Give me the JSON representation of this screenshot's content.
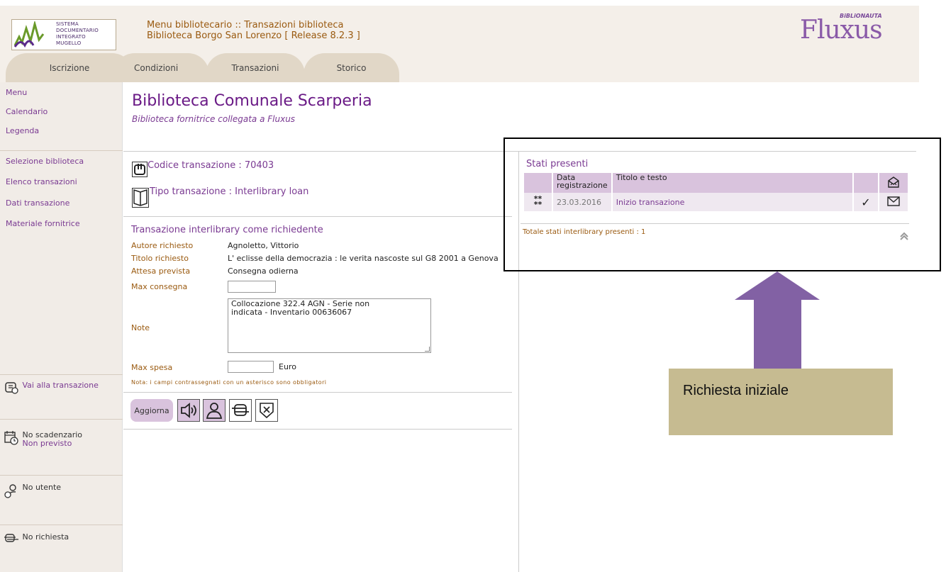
{
  "header": {
    "logo_lines": [
      "SISTEMA",
      "DOCUMENTARIO",
      "INTEGRATO",
      "MUGELLO"
    ],
    "title_line1": "Menu bibliotecario :: Transazioni biblioteca",
    "title_line2": "Biblioteca Borgo San Lorenzo [ Release 8.2.3 ]",
    "brand": "Fluxus",
    "brand_sub": "BiBLiONAUTA"
  },
  "tabs": [
    "Iscrizione",
    "Condizioni",
    "Transazioni",
    "Storico"
  ],
  "sidebar": {
    "menu": [
      "Menu",
      "Calendario",
      "Legenda"
    ],
    "nav": [
      "Selezione biblioteca",
      "Elenco transazioni",
      "Dati transazione",
      "Materiale fornitrice"
    ],
    "vai": "Vai alla transazione",
    "scadenzario_1": "No scadenzario",
    "scadenzario_2": "Non previsto",
    "utente": "No utente",
    "richiesta": "No richiesta"
  },
  "main": {
    "title": "Biblioteca Comunale Scarperia",
    "subtitle": "Biblioteca fornitrice collegata a Fluxus",
    "codice": "Codice transazione : 70403",
    "tipo": "Tipo transazione : Interlibrary loan",
    "section_title": "Transazione interlibrary come richiedente",
    "fields": {
      "autore_label": "Autore richiesto",
      "autore_value": "Agnoletto, Vittorio",
      "titolo_label": "Titolo richiesto",
      "titolo_value": "L' eclisse della democrazia : le verita nascoste sul G8 2001 a Genova",
      "attesa_label": "Attesa prevista",
      "attesa_value": "Consegna odierna",
      "max_consegna_label": "Max consegna",
      "max_consegna_value": "",
      "note_label": "Note",
      "note_line1": "Collocazione 322.4 AGN - Serie non",
      "note_line2": "indicata - Inventario 00636067",
      "max_spesa_label": "Max spesa",
      "max_spesa_value": "",
      "euro": "Euro"
    },
    "nota": "Nota: i campi contrassegnati con un asterisco sono obbligatori",
    "aggiorna": "Aggiorna"
  },
  "stati": {
    "title": "Stati presenti",
    "col_data_1": "Data",
    "col_data_2": "registrazione",
    "col_titolo": "Titolo e testo",
    "row": {
      "marker": "**",
      "marker2": "**",
      "data": "23.03.2016",
      "titolo": "Inizio transazione",
      "check": "✓"
    },
    "totale": "Totale stati interlibrary presenti : 1"
  },
  "callout": {
    "text": "Richiesta iniziale"
  },
  "colors": {
    "accent_purple": "#7a3a92",
    "arrow": "#8261a4",
    "callout_bg": "#c6bb91",
    "label_brown": "#9a5a10"
  }
}
